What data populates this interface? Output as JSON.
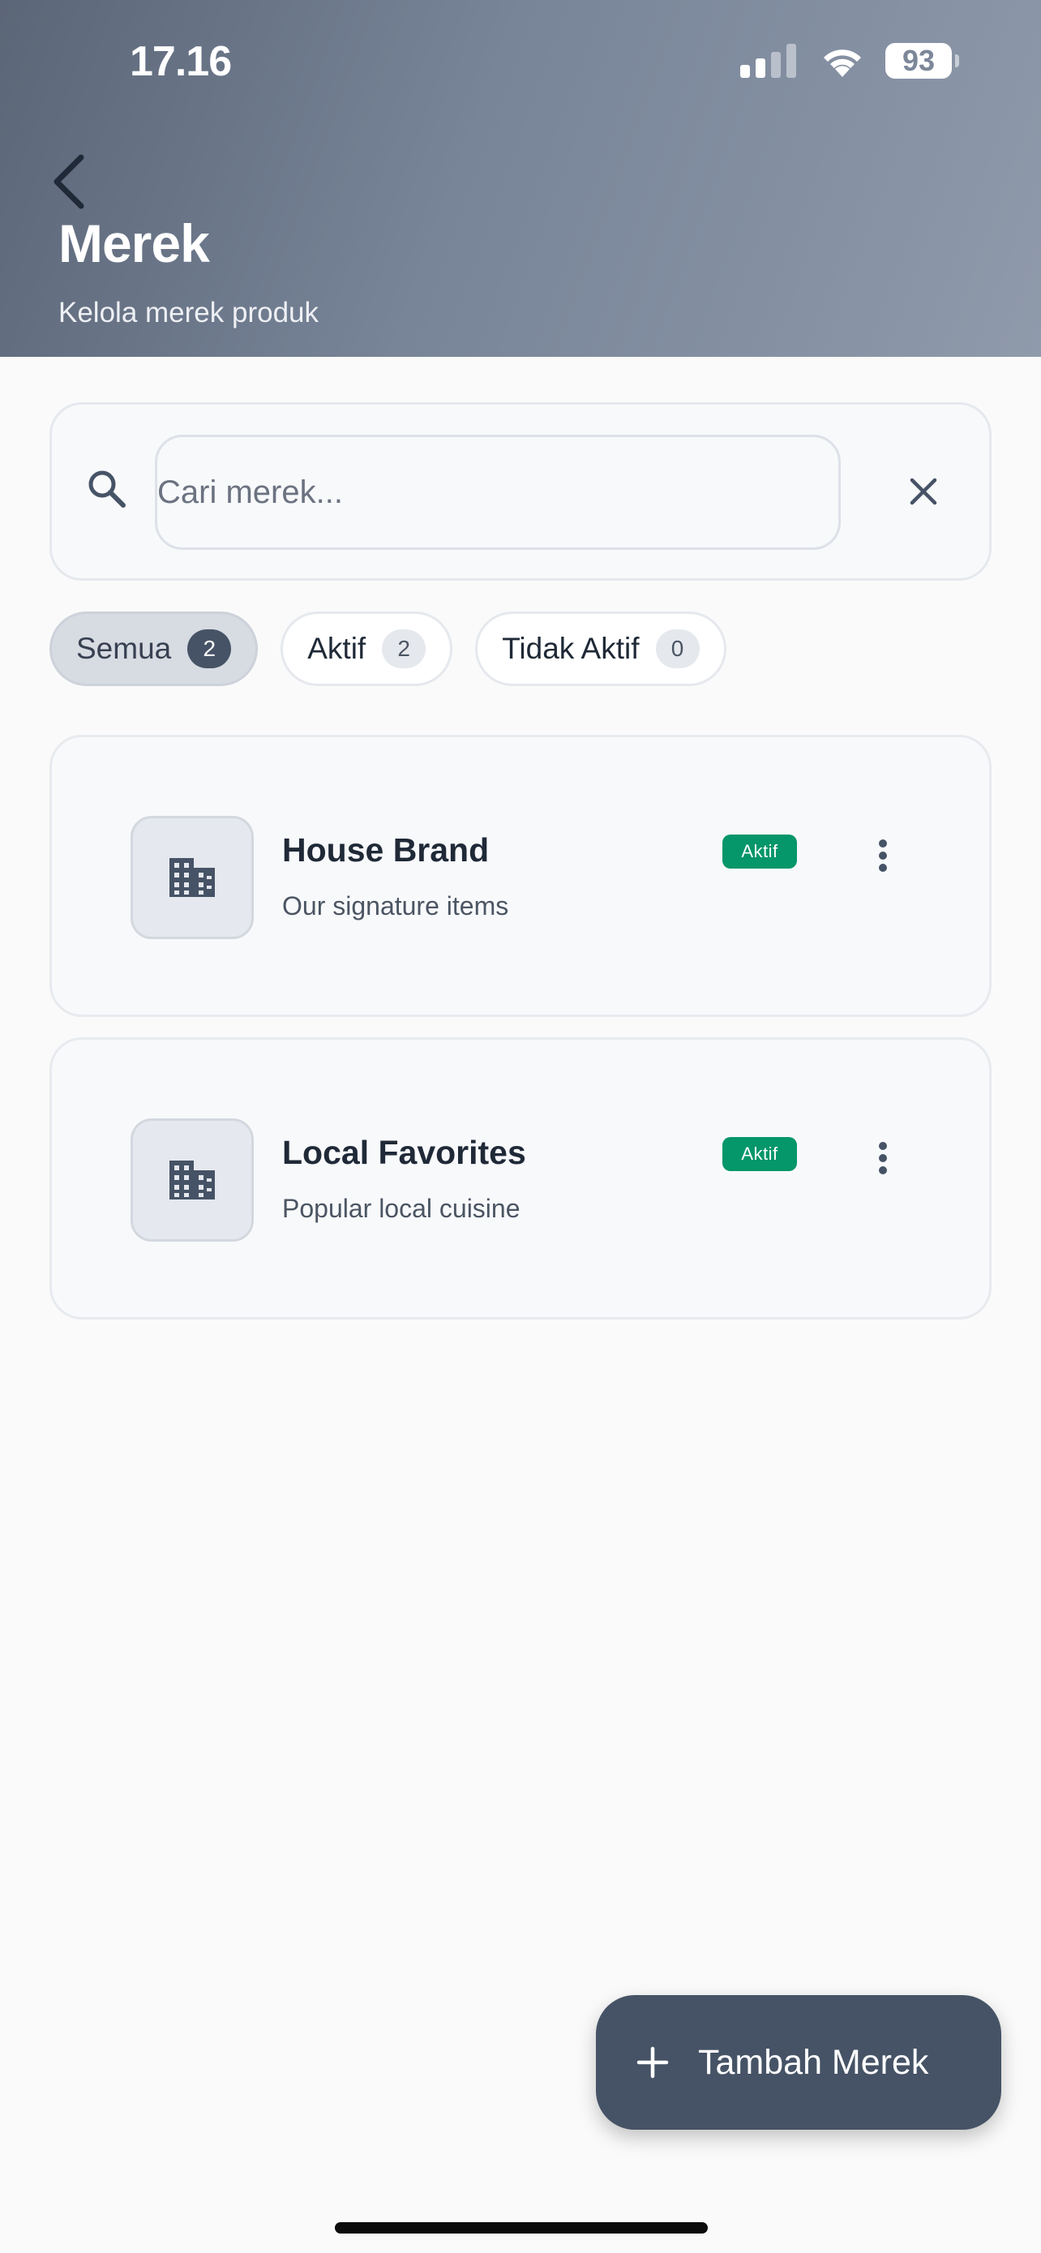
{
  "status_bar": {
    "time": "17.16",
    "battery": "93"
  },
  "header": {
    "title": "Merek",
    "subtitle": "Kelola merek produk"
  },
  "search": {
    "placeholder": "Cari merek...",
    "value": ""
  },
  "filters": [
    {
      "label": "Semua",
      "count": "2",
      "selected": true
    },
    {
      "label": "Aktif",
      "count": "2",
      "selected": false
    },
    {
      "label": "Tidak Aktif",
      "count": "0",
      "selected": false
    }
  ],
  "brands": [
    {
      "name": "House Brand",
      "description": "Our signature items",
      "status": "Aktif",
      "icon": "building-icon"
    },
    {
      "name": "Local Favorites",
      "description": "Popular local cuisine",
      "status": "Aktif",
      "icon": "building-icon"
    }
  ],
  "fab": {
    "label": "Tambah Merek",
    "icon": "plus-icon"
  },
  "colors": {
    "header_gradient_start": "#5b6677",
    "header_gradient_end": "#8f9aab",
    "accent_dark": "#465366",
    "status_active": "#059669",
    "background": "#fafafa"
  }
}
